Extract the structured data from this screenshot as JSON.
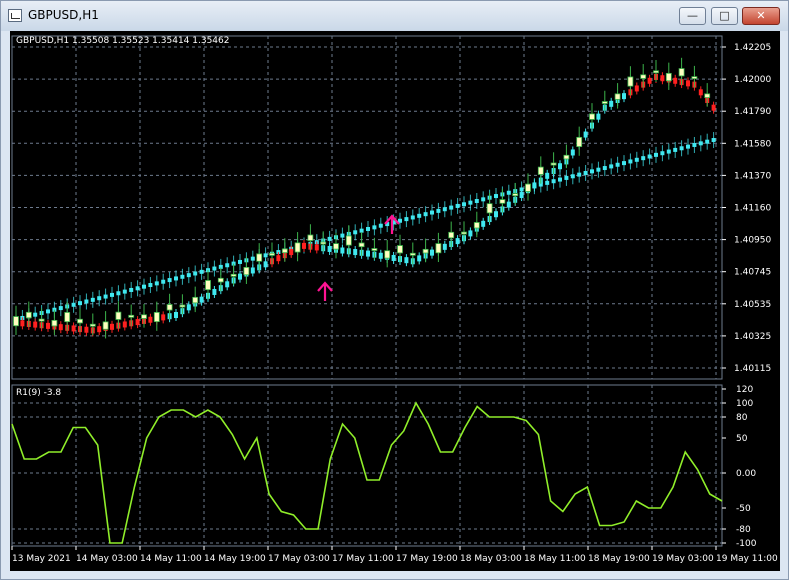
{
  "window": {
    "title": "GBPUSD,H1",
    "controls": {
      "minimize": "—",
      "maximize": "□",
      "close": "✕"
    },
    "icon": "chart-window-icon"
  },
  "main_chart": {
    "header": "GBPUSD,H1  1.35508 1.35523 1.35414 1.35462",
    "price_axis_labels": [
      "1.42205",
      "1.42000",
      "1.41790",
      "1.41580",
      "1.41370",
      "1.41160",
      "1.40950",
      "1.40745",
      "1.40535",
      "1.40325",
      "1.40115"
    ]
  },
  "indicator": {
    "label": "R1(9) -3.8",
    "axis_labels": [
      "120",
      "100",
      "80",
      "50",
      "0.00",
      "-50",
      "-80",
      "-100"
    ]
  },
  "time_axis": {
    "labels": [
      "13 May 2021",
      "14 May 03:00",
      "14 May 11:00",
      "14 May 19:00",
      "17 May 03:00",
      "17 May 11:00",
      "17 May 19:00",
      "18 May 03:00",
      "18 May 11:00",
      "18 May 19:00",
      "19 May 03:00",
      "19 May 11:00"
    ]
  },
  "colors": {
    "background": "#000000",
    "grid": "#6e7b8e",
    "bull_candle": "#ffffc0",
    "wick": "#3cb44b",
    "trend_line": "#40e8f0",
    "bear_line": "#ff2020",
    "arrow": "#ff1493",
    "oscillator": "#90ee2a",
    "axis_text": "#ffffff"
  },
  "chart_data": [
    {
      "type": "candlestick",
      "symbol": "GBPUSD",
      "timeframe": "H1",
      "ylim": [
        1.40115,
        1.42205
      ],
      "markers": [
        {
          "type": "buy-arrow"
        },
        {
          "type": "buy-arrow"
        }
      ]
    },
    {
      "type": "line",
      "ylim": [
        -120,
        120
      ],
      "series": [
        {
          "values": [
            70,
            20,
            20,
            30,
            30,
            65,
            65,
            40,
            -100,
            -100,
            -20,
            50,
            80,
            90,
            90,
            80,
            90,
            80,
            55,
            20,
            50,
            -30,
            -55,
            -60,
            -80,
            -80,
            20,
            70,
            50,
            -10,
            -10,
            40,
            60,
            100,
            70,
            30,
            30,
            65,
            95,
            80,
            80,
            80,
            75,
            55,
            -40,
            -55,
            -30,
            -20,
            -75,
            -75,
            -70,
            -40,
            -50,
            -50,
            -20,
            30,
            5,
            -30,
            -40
          ]
        }
      ]
    }
  ]
}
